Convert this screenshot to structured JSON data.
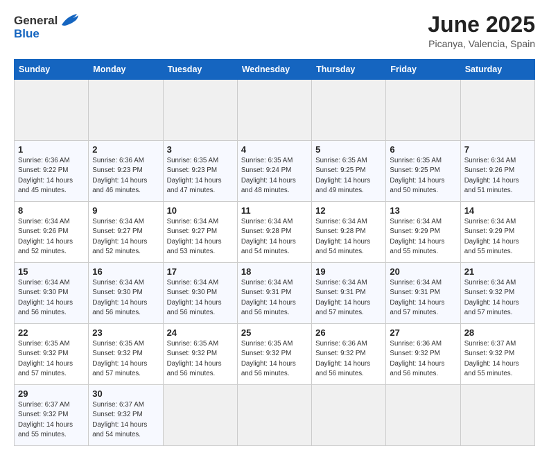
{
  "header": {
    "logo_general": "General",
    "logo_blue": "Blue",
    "title": "June 2025",
    "subtitle": "Picanya, Valencia, Spain"
  },
  "calendar": {
    "days_of_week": [
      "Sunday",
      "Monday",
      "Tuesday",
      "Wednesday",
      "Thursday",
      "Friday",
      "Saturday"
    ],
    "weeks": [
      [
        {
          "day": "",
          "empty": true
        },
        {
          "day": "",
          "empty": true
        },
        {
          "day": "",
          "empty": true
        },
        {
          "day": "",
          "empty": true
        },
        {
          "day": "",
          "empty": true
        },
        {
          "day": "",
          "empty": true
        },
        {
          "day": "",
          "empty": true
        }
      ],
      [
        {
          "day": "1",
          "sunrise": "6:36 AM",
          "sunset": "9:22 PM",
          "daylight": "14 hours and 45 minutes."
        },
        {
          "day": "2",
          "sunrise": "6:36 AM",
          "sunset": "9:23 PM",
          "daylight": "14 hours and 46 minutes."
        },
        {
          "day": "3",
          "sunrise": "6:35 AM",
          "sunset": "9:23 PM",
          "daylight": "14 hours and 47 minutes."
        },
        {
          "day": "4",
          "sunrise": "6:35 AM",
          "sunset": "9:24 PM",
          "daylight": "14 hours and 48 minutes."
        },
        {
          "day": "5",
          "sunrise": "6:35 AM",
          "sunset": "9:25 PM",
          "daylight": "14 hours and 49 minutes."
        },
        {
          "day": "6",
          "sunrise": "6:35 AM",
          "sunset": "9:25 PM",
          "daylight": "14 hours and 50 minutes."
        },
        {
          "day": "7",
          "sunrise": "6:34 AM",
          "sunset": "9:26 PM",
          "daylight": "14 hours and 51 minutes."
        }
      ],
      [
        {
          "day": "8",
          "sunrise": "6:34 AM",
          "sunset": "9:26 PM",
          "daylight": "14 hours and 52 minutes."
        },
        {
          "day": "9",
          "sunrise": "6:34 AM",
          "sunset": "9:27 PM",
          "daylight": "14 hours and 52 minutes."
        },
        {
          "day": "10",
          "sunrise": "6:34 AM",
          "sunset": "9:27 PM",
          "daylight": "14 hours and 53 minutes."
        },
        {
          "day": "11",
          "sunrise": "6:34 AM",
          "sunset": "9:28 PM",
          "daylight": "14 hours and 54 minutes."
        },
        {
          "day": "12",
          "sunrise": "6:34 AM",
          "sunset": "9:28 PM",
          "daylight": "14 hours and 54 minutes."
        },
        {
          "day": "13",
          "sunrise": "6:34 AM",
          "sunset": "9:29 PM",
          "daylight": "14 hours and 55 minutes."
        },
        {
          "day": "14",
          "sunrise": "6:34 AM",
          "sunset": "9:29 PM",
          "daylight": "14 hours and 55 minutes."
        }
      ],
      [
        {
          "day": "15",
          "sunrise": "6:34 AM",
          "sunset": "9:30 PM",
          "daylight": "14 hours and 56 minutes."
        },
        {
          "day": "16",
          "sunrise": "6:34 AM",
          "sunset": "9:30 PM",
          "daylight": "14 hours and 56 minutes."
        },
        {
          "day": "17",
          "sunrise": "6:34 AM",
          "sunset": "9:30 PM",
          "daylight": "14 hours and 56 minutes."
        },
        {
          "day": "18",
          "sunrise": "6:34 AM",
          "sunset": "9:31 PM",
          "daylight": "14 hours and 56 minutes."
        },
        {
          "day": "19",
          "sunrise": "6:34 AM",
          "sunset": "9:31 PM",
          "daylight": "14 hours and 57 minutes."
        },
        {
          "day": "20",
          "sunrise": "6:34 AM",
          "sunset": "9:31 PM",
          "daylight": "14 hours and 57 minutes."
        },
        {
          "day": "21",
          "sunrise": "6:34 AM",
          "sunset": "9:32 PM",
          "daylight": "14 hours and 57 minutes."
        }
      ],
      [
        {
          "day": "22",
          "sunrise": "6:35 AM",
          "sunset": "9:32 PM",
          "daylight": "14 hours and 57 minutes."
        },
        {
          "day": "23",
          "sunrise": "6:35 AM",
          "sunset": "9:32 PM",
          "daylight": "14 hours and 57 minutes."
        },
        {
          "day": "24",
          "sunrise": "6:35 AM",
          "sunset": "9:32 PM",
          "daylight": "14 hours and 56 minutes."
        },
        {
          "day": "25",
          "sunrise": "6:35 AM",
          "sunset": "9:32 PM",
          "daylight": "14 hours and 56 minutes."
        },
        {
          "day": "26",
          "sunrise": "6:36 AM",
          "sunset": "9:32 PM",
          "daylight": "14 hours and 56 minutes."
        },
        {
          "day": "27",
          "sunrise": "6:36 AM",
          "sunset": "9:32 PM",
          "daylight": "14 hours and 56 minutes."
        },
        {
          "day": "28",
          "sunrise": "6:37 AM",
          "sunset": "9:32 PM",
          "daylight": "14 hours and 55 minutes."
        }
      ],
      [
        {
          "day": "29",
          "sunrise": "6:37 AM",
          "sunset": "9:32 PM",
          "daylight": "14 hours and 55 minutes."
        },
        {
          "day": "30",
          "sunrise": "6:37 AM",
          "sunset": "9:32 PM",
          "daylight": "14 hours and 54 minutes."
        },
        {
          "day": "",
          "empty": true
        },
        {
          "day": "",
          "empty": true
        },
        {
          "day": "",
          "empty": true
        },
        {
          "day": "",
          "empty": true
        },
        {
          "day": "",
          "empty": true
        }
      ]
    ]
  }
}
